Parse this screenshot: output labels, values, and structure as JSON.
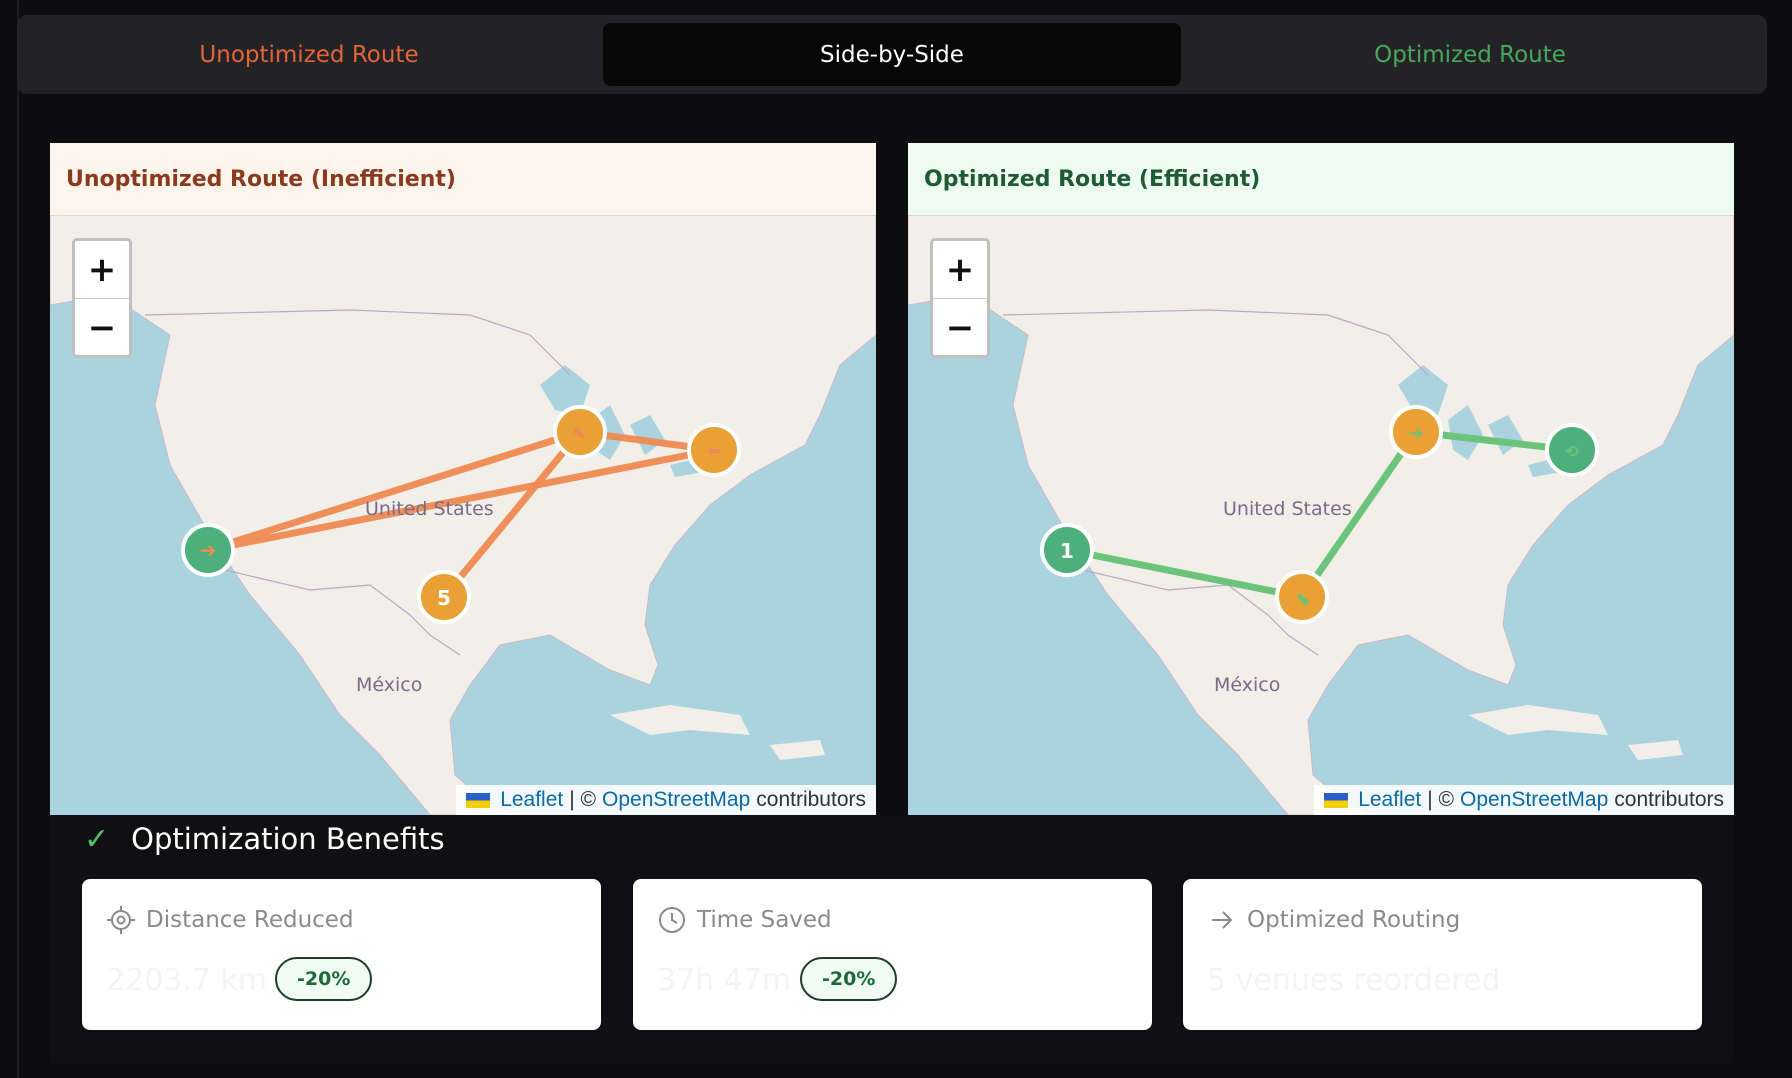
{
  "tabs": {
    "unoptimized": "Unoptimized Route",
    "side_by_side": "Side-by-Side",
    "optimized": "Optimized Route"
  },
  "maps": {
    "left": {
      "title": "Unoptimized Route (Inefficient)",
      "label_us": "United States",
      "label_mexico": "México",
      "stop_numbers": [
        "5"
      ]
    },
    "right": {
      "title": "Optimized Route (Efficient)",
      "label_us": "United States",
      "label_mexico": "México",
      "stop_numbers": [
        "1"
      ]
    },
    "zoom_in": "+",
    "zoom_out": "−",
    "attribution": {
      "leaflet": "Leaflet",
      "sep": "| ©",
      "osm": "OpenStreetMap",
      "contributors": "contributors"
    }
  },
  "benefits": {
    "title": "Optimization Benefits",
    "cards": [
      {
        "label": "Distance Reduced",
        "value": "2203.7 km",
        "badge": "-20%",
        "icon": "target-icon"
      },
      {
        "label": "Time Saved",
        "value": "37h 47m",
        "badge": "-20%",
        "icon": "clock-icon"
      },
      {
        "label": "Optimized Routing",
        "value": "5 venues reordered",
        "icon": "arrow-right-icon"
      }
    ]
  },
  "colors": {
    "unoptimized_route": "#ee8a52",
    "optimized_route": "#6cc47c",
    "stop_orange": "#e9a136",
    "stop_green": "#4daf7c"
  }
}
